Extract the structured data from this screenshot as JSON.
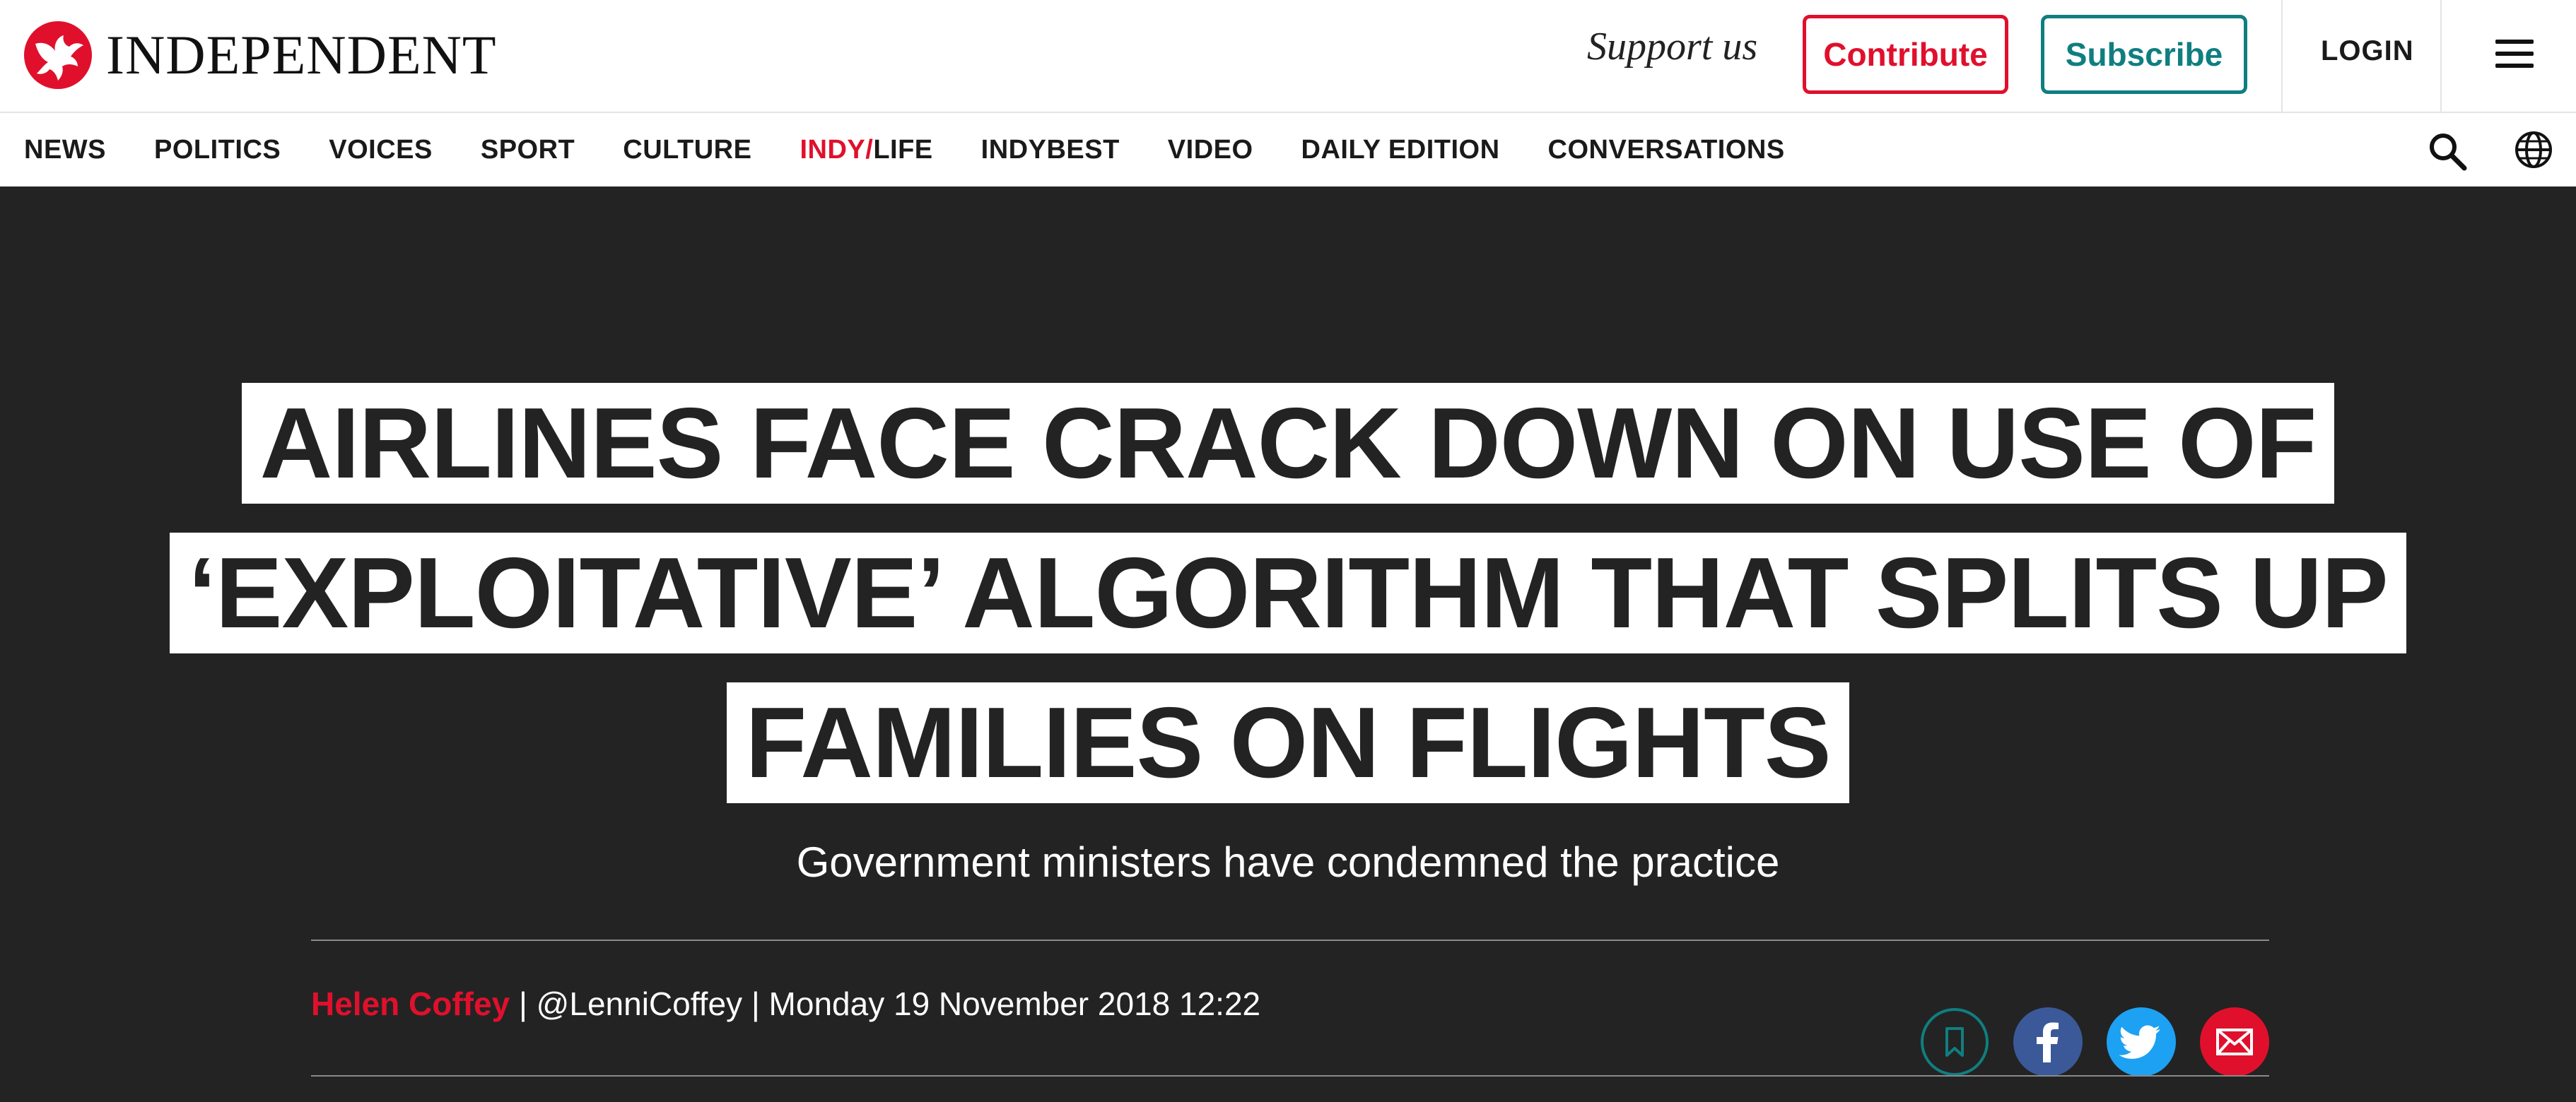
{
  "header": {
    "logo_text": "INDEPENDENT",
    "support_text": "Support us",
    "contribute_label": "Contribute",
    "subscribe_label": "Subscribe",
    "login_label": "LOGIN",
    "icons": [
      "eagle-logo-icon",
      "menu-icon"
    ]
  },
  "nav": {
    "items": [
      "NEWS",
      "POLITICS",
      "VOICES",
      "SPORT",
      "CULTURE"
    ],
    "indy_prefix": "INDY/",
    "indy_suffix": "LIFE",
    "items_after": [
      "INDYBEST",
      "VIDEO",
      "DAILY EDITION",
      "CONVERSATIONS"
    ],
    "icons": [
      "search-icon",
      "globe-icon"
    ]
  },
  "article": {
    "headline": "AIRLINES FACE CRACK DOWN ON USE OF ‘EXPLOITATIVE’ ALGORITHM THAT SPLITS UP FAMILIES ON FLIGHTS",
    "standfirst": "Government ministers have condemned the practice",
    "author": "Helen Coffey",
    "meta": " | @LenniCoffey | Monday 19 November 2018 12:22",
    "share_icons": [
      "bookmark-icon",
      "facebook-icon",
      "twitter-icon",
      "email-icon"
    ]
  },
  "colors": {
    "brand_red": "#e0102c",
    "subscribe_teal": "#107e80",
    "hero_bg": "#232323",
    "facebook": "#3b5998",
    "twitter": "#1da1f2"
  }
}
